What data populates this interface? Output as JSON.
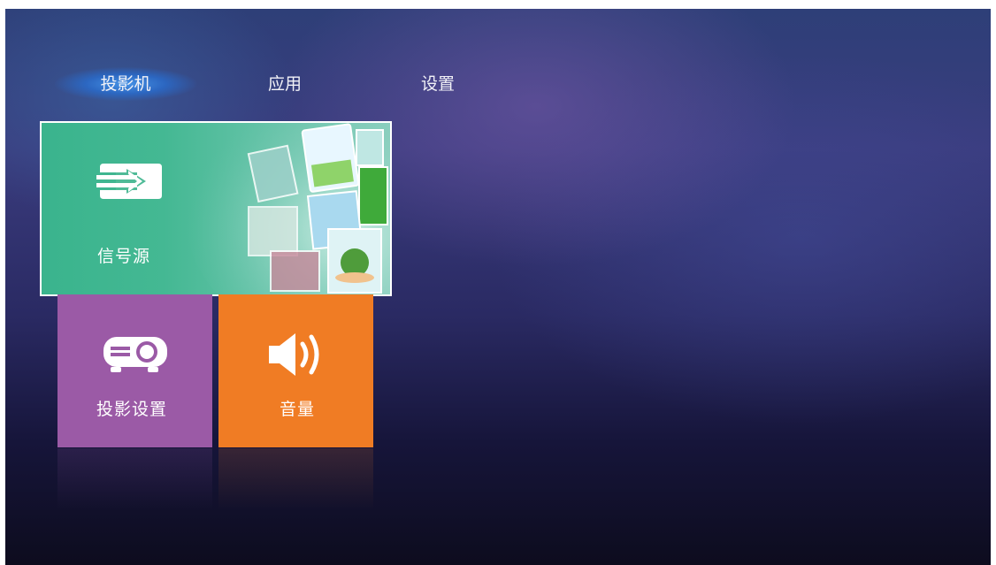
{
  "tabs": [
    {
      "label": "投影机",
      "active": true
    },
    {
      "label": "应用",
      "active": false
    },
    {
      "label": "设置",
      "active": false
    }
  ],
  "tiles": {
    "source": {
      "label": "信号源",
      "icon": "input-arrow-icon",
      "color": "#3ab48d",
      "selected": true
    },
    "projection_settings": {
      "label": "投影设置",
      "icon": "projector-icon",
      "color": "#9b5aa6"
    },
    "volume": {
      "label": "音量",
      "icon": "speaker-icon",
      "color": "#f07c24"
    }
  },
  "colors": {
    "background_top": "#2e3f78",
    "background_bottom": "#0d0c1e",
    "tab_highlight": "#3c8ce0"
  }
}
